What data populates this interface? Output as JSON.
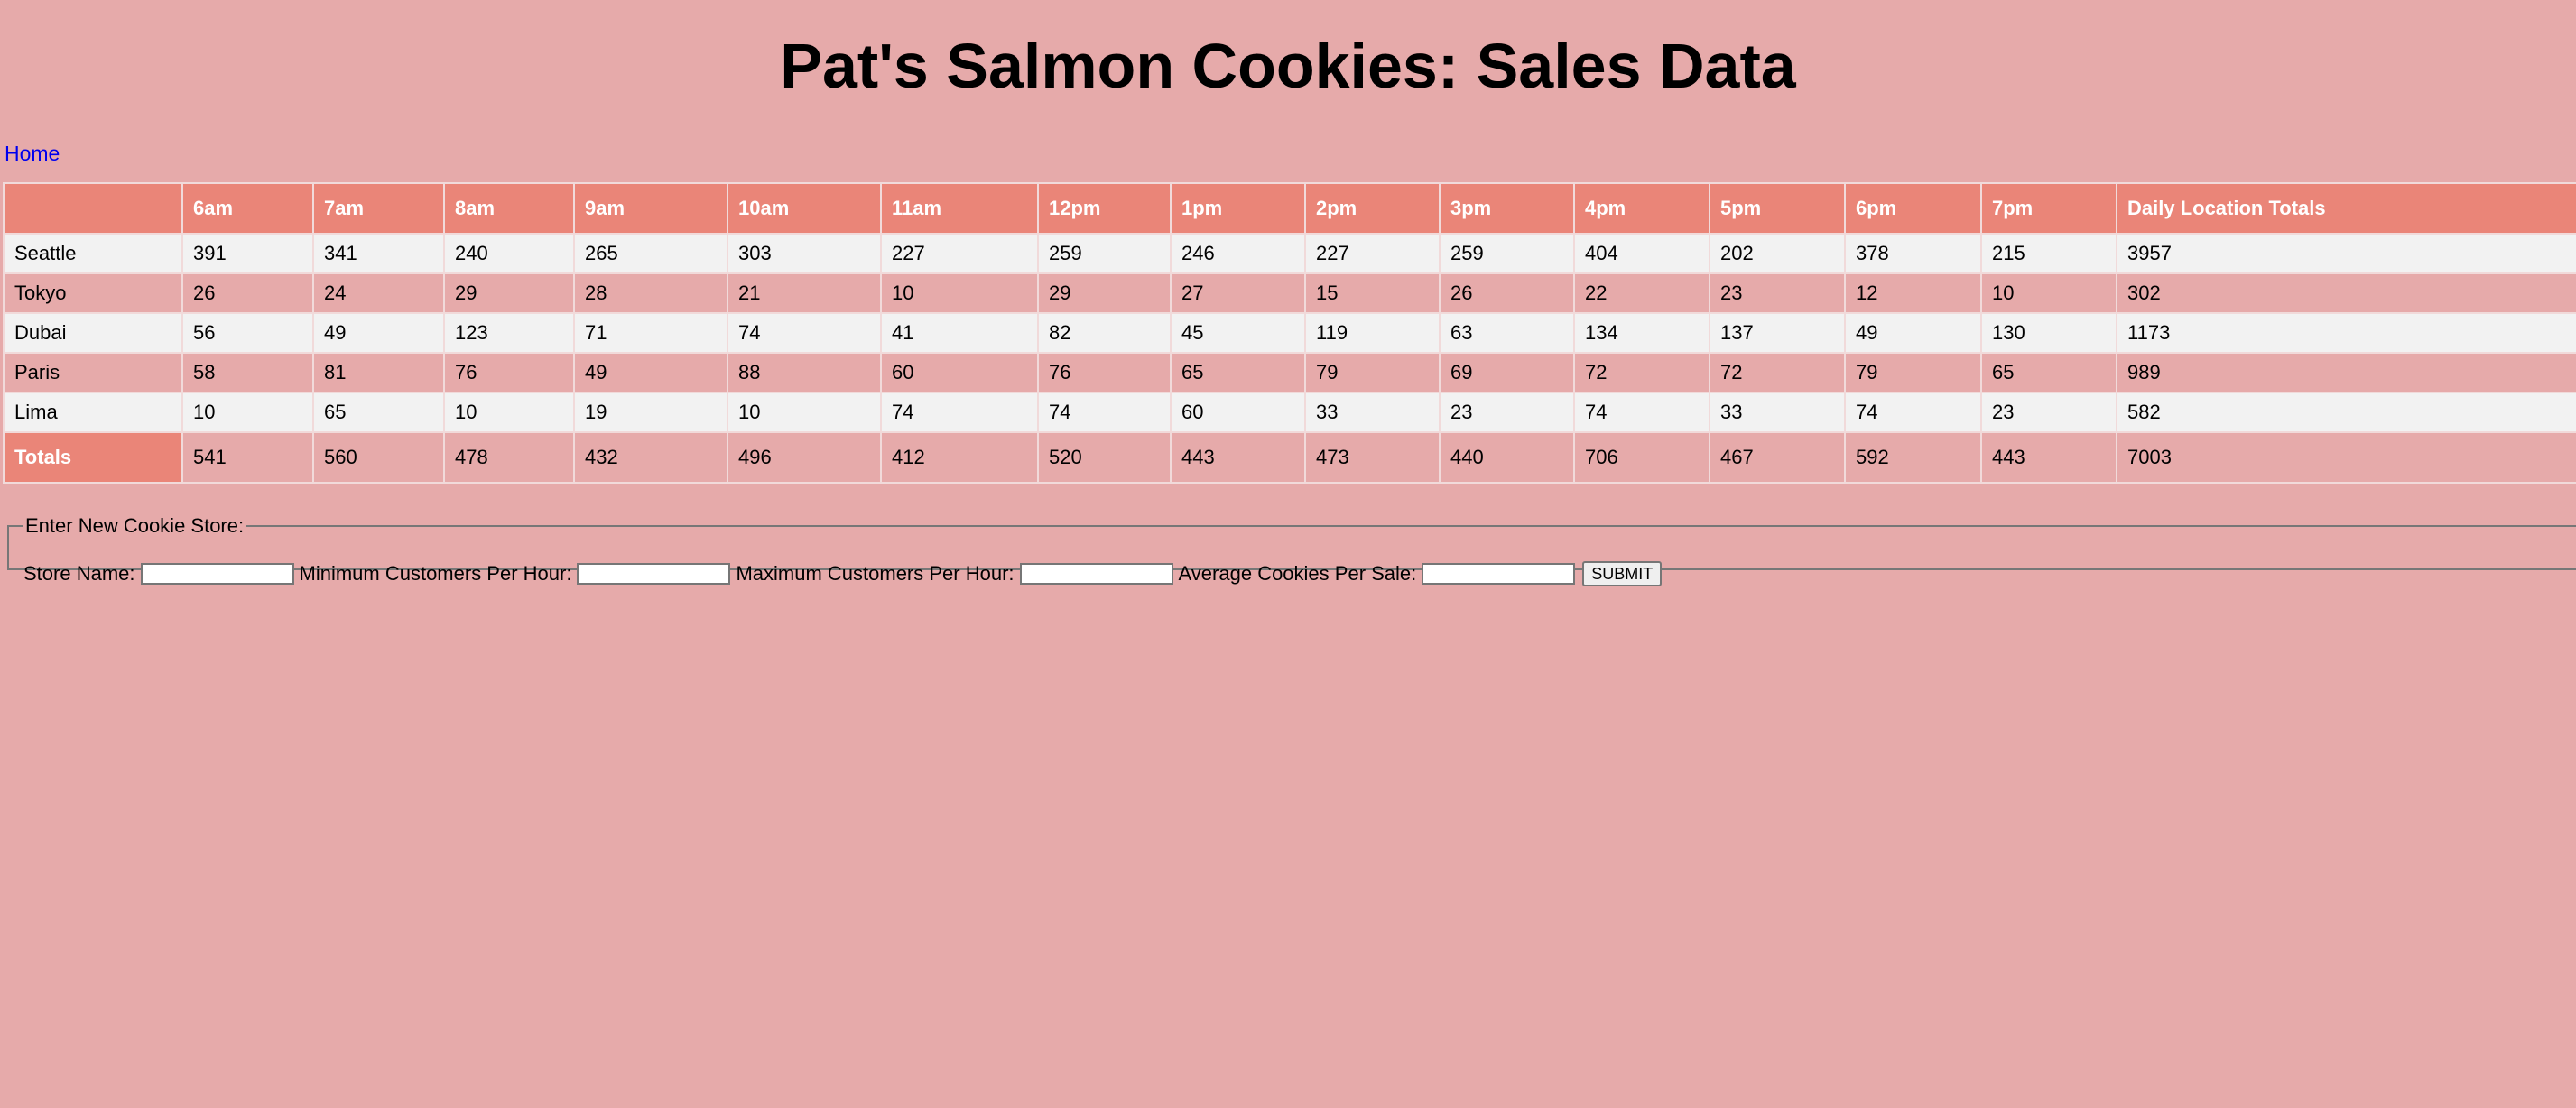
{
  "page": {
    "title": "Pat's Salmon Cookies: Sales Data",
    "nav_home": "Home"
  },
  "table": {
    "corner": "",
    "headers": [
      "6am",
      "7am",
      "8am",
      "9am",
      "10am",
      "11am",
      "12pm",
      "1pm",
      "2pm",
      "3pm",
      "4pm",
      "5pm",
      "6pm",
      "7pm",
      "Daily Location Totals"
    ],
    "rows": [
      {
        "name": "Seattle",
        "values": [
          "391",
          "341",
          "240",
          "265",
          "303",
          "227",
          "259",
          "246",
          "227",
          "259",
          "404",
          "202",
          "378",
          "215",
          "3957"
        ]
      },
      {
        "name": "Tokyo",
        "values": [
          "26",
          "24",
          "29",
          "28",
          "21",
          "10",
          "29",
          "27",
          "15",
          "26",
          "22",
          "23",
          "12",
          "10",
          "302"
        ]
      },
      {
        "name": "Dubai",
        "values": [
          "56",
          "49",
          "123",
          "71",
          "74",
          "41",
          "82",
          "45",
          "119",
          "63",
          "134",
          "137",
          "49",
          "130",
          "1173"
        ]
      },
      {
        "name": "Paris",
        "values": [
          "58",
          "81",
          "76",
          "49",
          "88",
          "60",
          "76",
          "65",
          "79",
          "69",
          "72",
          "72",
          "79",
          "65",
          "989"
        ]
      },
      {
        "name": "Lima",
        "values": [
          "10",
          "65",
          "10",
          "19",
          "10",
          "74",
          "74",
          "60",
          "33",
          "23",
          "74",
          "33",
          "74",
          "23",
          "582"
        ]
      }
    ],
    "totals": {
      "label": "Totals",
      "values": [
        "541",
        "560",
        "478",
        "432",
        "496",
        "412",
        "520",
        "443",
        "473",
        "440",
        "706",
        "467",
        "592",
        "443",
        "7003"
      ]
    }
  },
  "form": {
    "legend": "Enter New Cookie Store:",
    "store_name_label": "Store Name:",
    "min_customers_label": "Minimum Customers Per Hour:",
    "max_customers_label": "Maximum Customers Per Hour:",
    "avg_cookies_label": "Average Cookies Per Sale:",
    "store_name_value": "",
    "min_customers_value": "",
    "max_customers_value": "",
    "avg_cookies_value": "",
    "submit_label": "SUBMIT"
  },
  "colors": {
    "background": "#e6aaaa",
    "header": "#ea8578",
    "row_light": "#f2f2f2",
    "link": "#0000ee"
  }
}
